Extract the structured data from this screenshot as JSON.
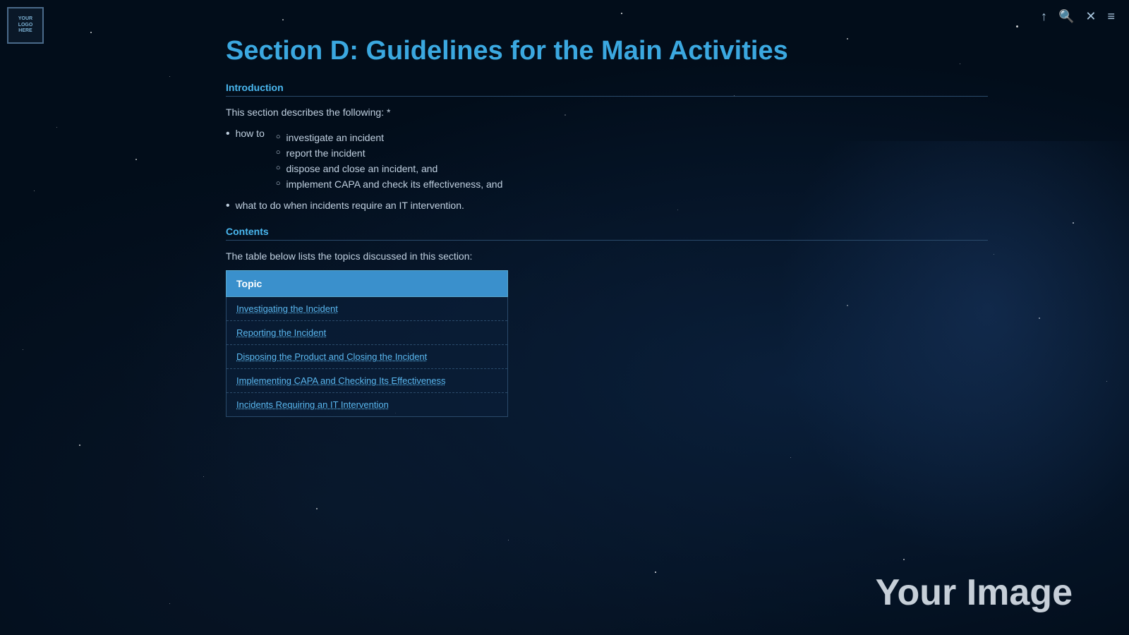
{
  "logo": {
    "lines": [
      "YOUR",
      "LOGO",
      "HERE"
    ]
  },
  "topIcons": {
    "upload": "↑",
    "search": "🔍",
    "close": "✕",
    "menu": "≡"
  },
  "section": {
    "title": "Section D: Guidelines for the Main Activities",
    "introLabel": "Introduction",
    "introText": "This section describes the following:  *",
    "bullets": [
      {
        "text": "how to",
        "subItems": [
          "investigate an incident",
          "report the incident",
          "dispose and close an incident, and",
          "implement CAPA and check its effectiveness, and"
        ]
      },
      {
        "text": "what to do when incidents require an IT intervention.",
        "subItems": []
      }
    ],
    "contentsLabel": "Contents",
    "tableIntro": "The table below lists the topics discussed in this section:",
    "tableHeader": "Topic",
    "tableRows": [
      "Investigating the Incident",
      "Reporting the Incident",
      "Disposing the Product and Closing the Incident",
      "Implementing CAPA and Checking Its Effectiveness",
      "Incidents Requiring an IT Intervention"
    ]
  },
  "watermark": "Your Image",
  "stars": []
}
